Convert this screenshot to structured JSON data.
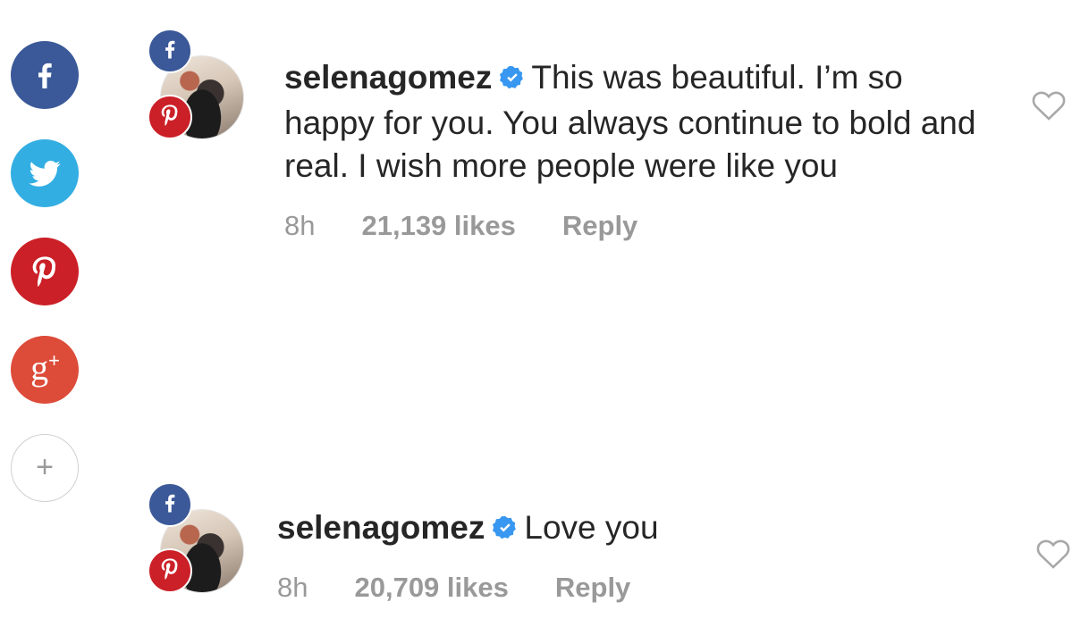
{
  "share_rail": {
    "buttons": [
      {
        "name": "facebook",
        "icon": "facebook-icon",
        "color": "#3b5998"
      },
      {
        "name": "twitter",
        "icon": "twitter-icon",
        "color": "#33aee3"
      },
      {
        "name": "pinterest",
        "icon": "pinterest-icon",
        "color": "#cb2027"
      },
      {
        "name": "google-plus",
        "icon": "google-plus-icon",
        "color": "#dd4b39",
        "label": "g+"
      },
      {
        "name": "more",
        "icon": "plus-icon",
        "label": "+"
      }
    ]
  },
  "comments": [
    {
      "username": "selenagomez",
      "verified": true,
      "text": "This was beautiful. I’m so happy for you. You always continue to bold and real. I wish more people were like you",
      "time": "8h",
      "likes": "21,139 likes",
      "reply": "Reply"
    },
    {
      "username": "selenagomez",
      "verified": true,
      "text": "Love you",
      "time": "8h",
      "likes": "20,709 likes",
      "reply": "Reply"
    }
  ],
  "colors": {
    "text": "#262626",
    "meta": "#999999",
    "verified": "#3897f0",
    "facebook": "#3b5998",
    "twitter": "#33aee3",
    "pinterest": "#cb2027",
    "google_plus": "#dd4b39"
  }
}
